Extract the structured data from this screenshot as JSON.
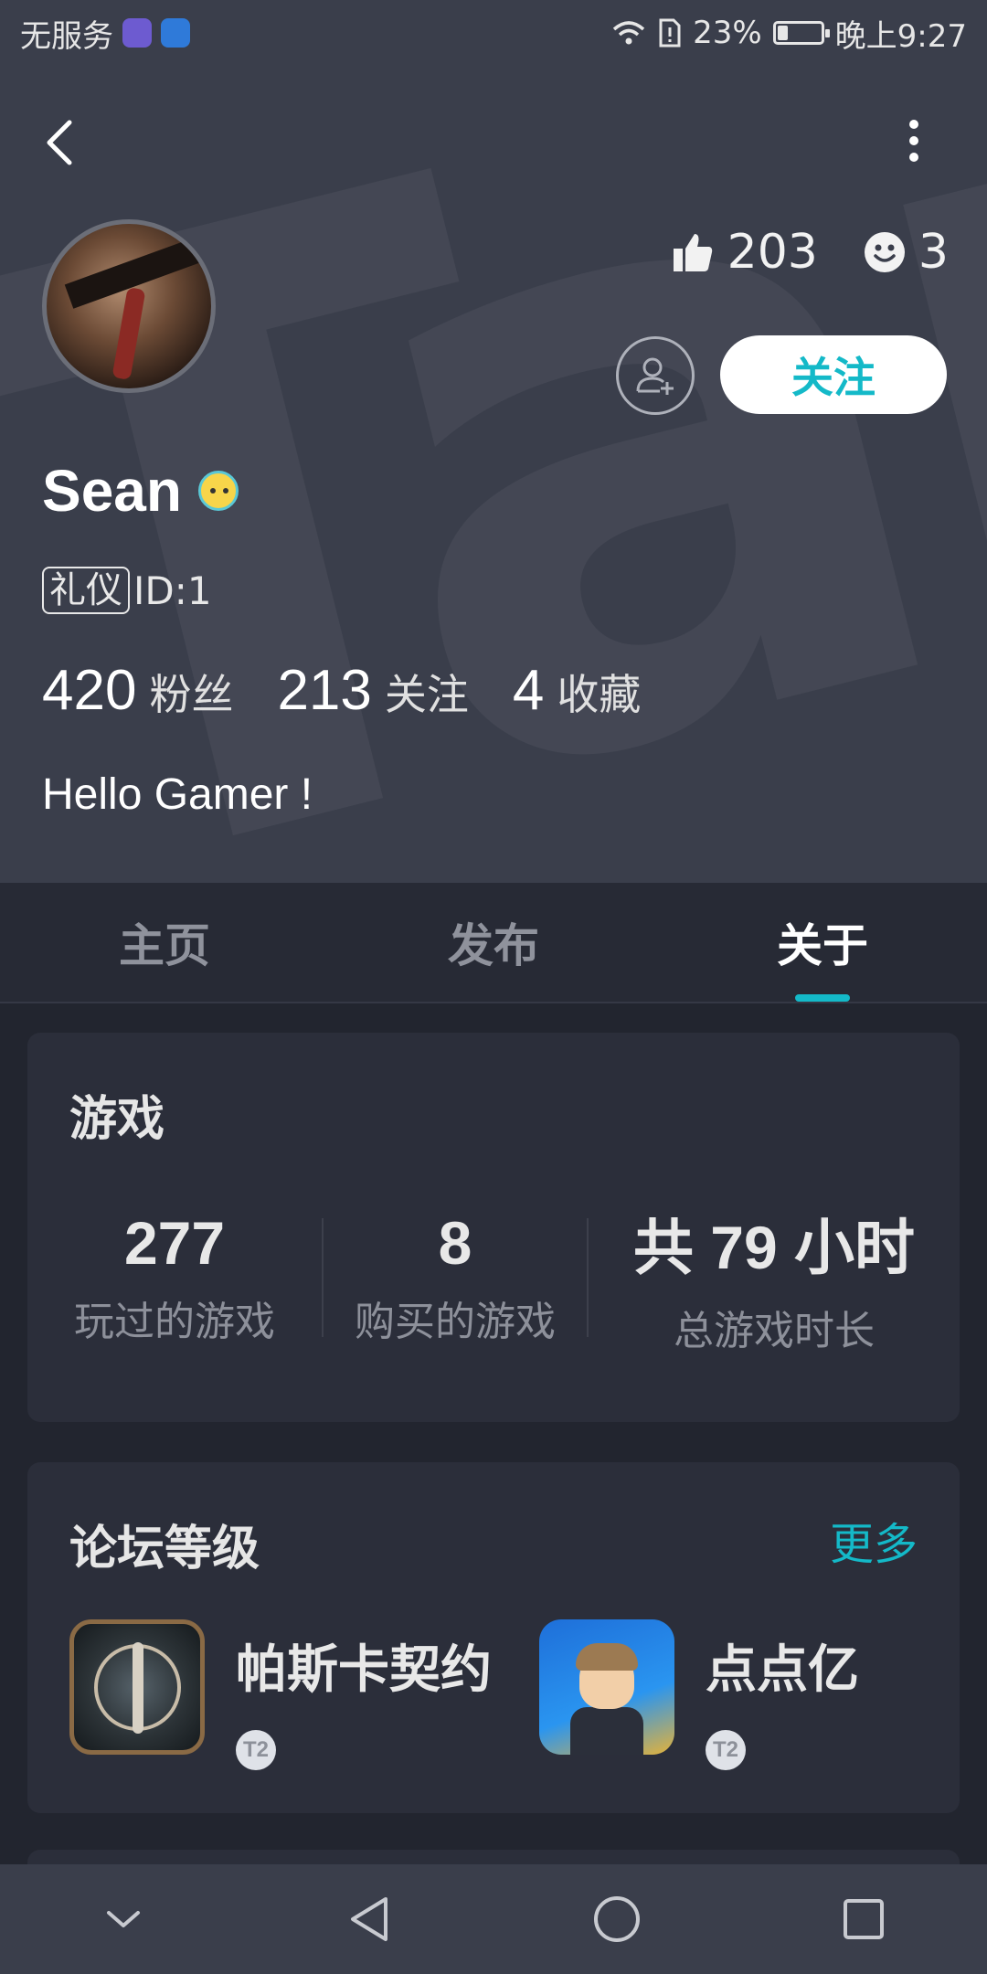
{
  "status_bar": {
    "carrier": "无服务",
    "battery": "23%",
    "battery_level": 0.23,
    "time": "晚上9:27"
  },
  "profile": {
    "likes": "203",
    "smiles": "3",
    "follow_label": "关注",
    "name": "Sean",
    "tag": "礼仪",
    "id_text": "ID:1",
    "fans_count": "420",
    "fans_label": "粉丝",
    "following_count": "213",
    "following_label": "关注",
    "favorites_count": "4",
    "favorites_label": "收藏",
    "bio": "Hello Gamer !"
  },
  "tabs": [
    {
      "label": "主页",
      "active": false
    },
    {
      "label": "发布",
      "active": false
    },
    {
      "label": "关于",
      "active": true
    }
  ],
  "games_card": {
    "title": "游戏",
    "stats": [
      {
        "value": "277",
        "label": "玩过的游戏"
      },
      {
        "value": "8",
        "label": "购买的游戏"
      },
      {
        "value": "共 79 小时",
        "label": "总游戏时长"
      }
    ]
  },
  "forum_card": {
    "title": "论坛等级",
    "more_label": "更多",
    "items": [
      {
        "name": "帕斯卡契约",
        "level": "T2"
      },
      {
        "name": "点点亿",
        "level": "T2"
      }
    ]
  },
  "colors": {
    "accent": "#14b9c8",
    "header_bg": "#3a3e4b",
    "page_bg": "#22252f",
    "card_bg": "#2b2e3a"
  },
  "icons": {
    "back": "chevron-left-icon",
    "more": "more-vertical-icon",
    "like": "thumbs-up-icon",
    "smile": "smile-icon",
    "add_friend": "add-user-icon"
  }
}
